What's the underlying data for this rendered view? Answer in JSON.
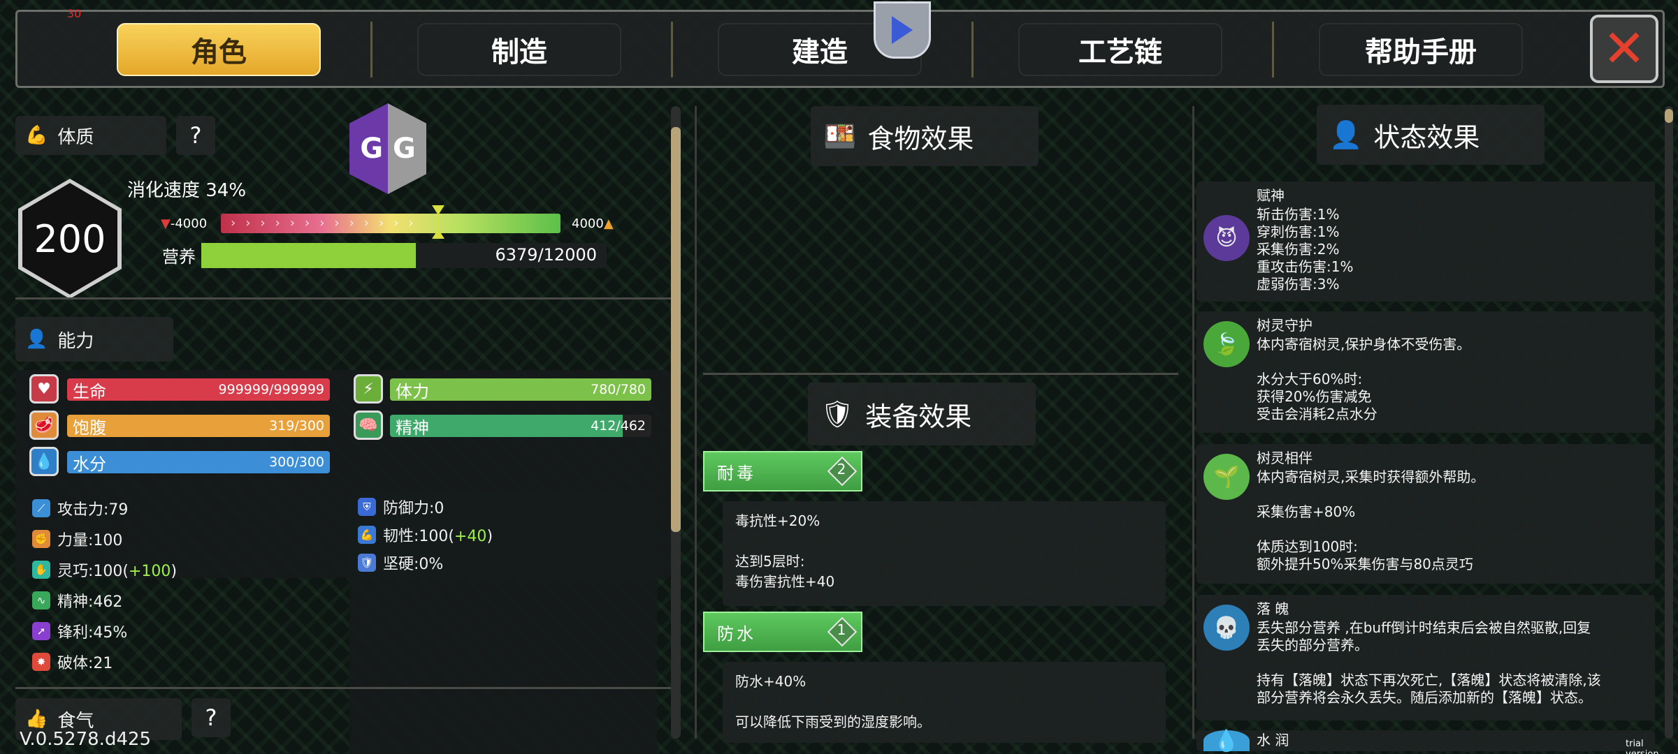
{
  "top_tabs": [
    {
      "label": "角色",
      "active": true
    },
    {
      "label": "制造",
      "active": false
    },
    {
      "label": "建造",
      "active": false
    },
    {
      "label": "工艺链",
      "active": false
    },
    {
      "label": "帮助手册",
      "active": false
    }
  ],
  "close_icon": "close-x-icon",
  "corner_number": "30",
  "gg_logo_letters": "G G",
  "constitution": {
    "label": "体质",
    "help": "?",
    "value": "200",
    "digestion_label": "消化速度 34%",
    "range_min": "-4000",
    "range_max": "4000",
    "indicator_fraction": 0.64,
    "nutrition_label": "营养",
    "nutrition_value": "6379/12000",
    "nutrition_fraction": 0.53
  },
  "ability": {
    "label": "能力",
    "bars": [
      {
        "name": "生命",
        "value": "999999/999999",
        "fraction": 1.0,
        "color": "#d83b4a"
      },
      {
        "name": "体力",
        "value": "780/780",
        "fraction": 1.0,
        "color": "#7cc24a"
      },
      {
        "name": "饱腹",
        "value": "319/300",
        "fraction": 1.0,
        "color": "#e8a03a"
      },
      {
        "name": "精神",
        "value": "412/462",
        "fraction": 0.89,
        "color": "#3fa86b"
      },
      {
        "name": "水分",
        "value": "300/300",
        "fraction": 1.0,
        "color": "#3c8fd6"
      }
    ],
    "stats_left": [
      {
        "label": "攻击力:79",
        "bonus": ""
      },
      {
        "label": "力量:100",
        "bonus": ""
      },
      {
        "label": "灵巧:100(",
        "bonus": "+100",
        "tail": ")"
      },
      {
        "label": "精神:462",
        "bonus": ""
      },
      {
        "label": "锋利:45%",
        "bonus": ""
      },
      {
        "label": "破体:21",
        "bonus": ""
      }
    ],
    "stats_right": [
      {
        "label": "防御力:0",
        "bonus": ""
      },
      {
        "label": "韧性:100(",
        "bonus": "+40",
        "tail": ")"
      },
      {
        "label": "坚硬:0%",
        "bonus": ""
      }
    ]
  },
  "food_qi": {
    "label": "食气",
    "help": "?"
  },
  "food_effect": {
    "title": "食物效果"
  },
  "equip_effect": {
    "title": "装备效果",
    "items": [
      {
        "name": "耐毒",
        "count": "2",
        "desc": "毒抗性+20%\n\n达到5层时:\n毒伤害抗性+40"
      },
      {
        "name": "防水",
        "count": "1",
        "desc": "防水+40%\n\n可以降低下雨受到的湿度影响。"
      }
    ]
  },
  "status_effect": {
    "title": "状态效果",
    "items": [
      {
        "name": "赋神",
        "text": "斩击伤害:1%\n穿刺伤害:1%\n采集伤害:2%\n重攻击伤害:1%\n虚弱伤害:3%",
        "icon": "demon-face-icon",
        "color": "#6a3fa8"
      },
      {
        "name": "树灵守护",
        "text": "体内寄宿树灵,保护身体不受伤害。\n\n水分大于60%时:\n获得20%伤害减免\n受击会消耗2点水分",
        "icon": "leaf-icon",
        "color": "#4aa83a"
      },
      {
        "name": "树灵相伴",
        "text": "体内寄宿树灵,采集时获得额外帮助。\n\n采集伤害+80%\n\n体质达到100时:\n额外提升50%采集伤害与80点灵巧",
        "icon": "tree-spirit-icon",
        "color": "#5cb84a"
      },
      {
        "name": "落 魄",
        "text": "丢失部分营养 ,在buff倒计时结束后会被自然驱散,回复\n丢失的部分营养。\n\n持有【落魄】状态下再次死亡,【落魄】状态将被清除,该\n部分营养将会永久丢失。随后添加新的【落魄】状态。",
        "icon": "skull-icon",
        "color": "#2d7fb8"
      },
      {
        "name": "水 润",
        "text": "",
        "icon": "water-drop-icon",
        "color": "#3a9fd6"
      }
    ]
  },
  "version": "V.0.5278.d425",
  "trial": "trial version"
}
